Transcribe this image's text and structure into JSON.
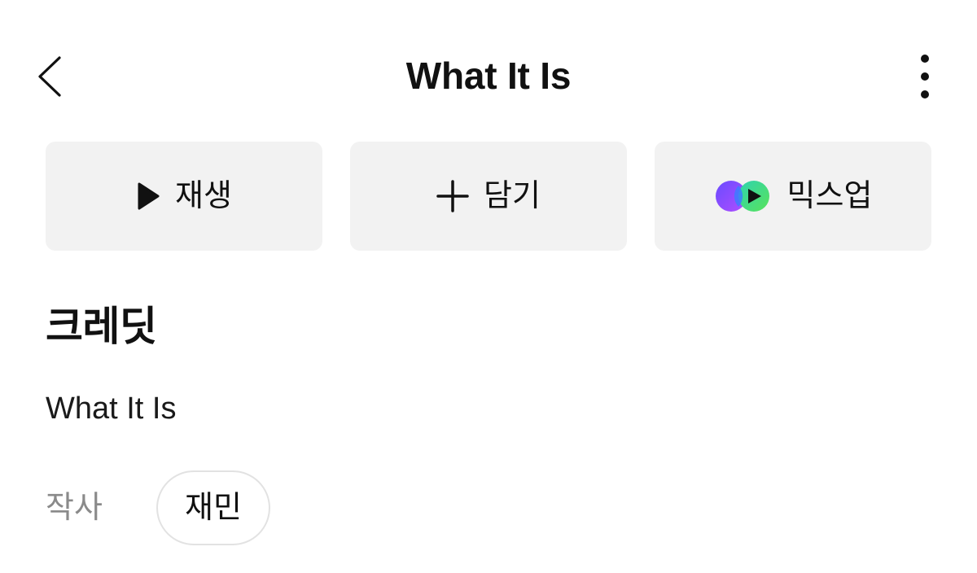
{
  "header": {
    "title": "What It Is",
    "back_icon": "chevron-left-icon",
    "more_icon": "more-vertical-icon"
  },
  "actions": [
    {
      "label": "재생",
      "icon": "play-icon"
    },
    {
      "label": "담기",
      "icon": "plus-icon"
    },
    {
      "label": "믹스업",
      "icon": "mixup-icon"
    }
  ],
  "credits": {
    "heading": "크레딧",
    "song_title": "What It Is",
    "roles": [
      {
        "role": "작사",
        "artist": "재민"
      }
    ]
  },
  "colors": {
    "button_bg": "#f2f2f2",
    "text_primary": "#111111",
    "text_secondary": "#8a8a8a",
    "chip_border": "#e2e2e2",
    "mixup_purple": "#7b4dff",
    "mixup_green": "#3ddc6c"
  }
}
